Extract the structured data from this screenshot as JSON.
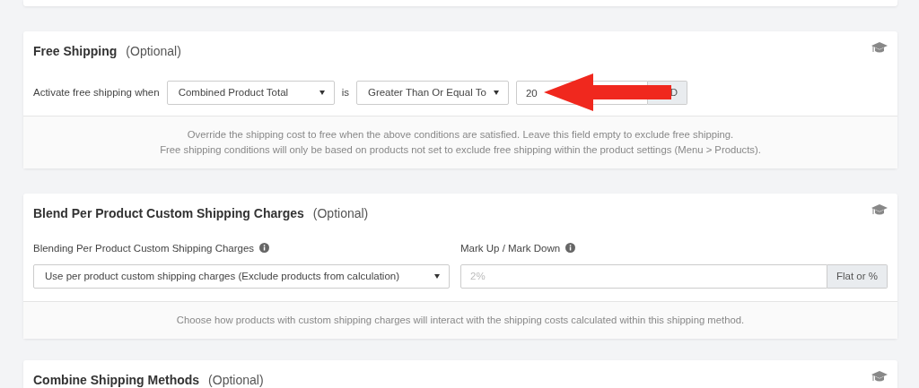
{
  "free_shipping": {
    "title": "Free Shipping",
    "tag": "(Optional)",
    "condition_label": "Activate free shipping when",
    "field_select": "Combined Product Total",
    "connector": "is",
    "operator_select": "Greater Than Or Equal To",
    "amount_value": "20",
    "amount_addon": "D",
    "notes": [
      "Override the shipping cost to free when the above conditions are satisfied. Leave this field empty to exclude free shipping.",
      "Free shipping conditions will only be based on products not set to exclude free shipping within the product settings (Menu > Products)."
    ]
  },
  "blend": {
    "title": "Blend Per Product Custom Shipping Charges",
    "tag": "(Optional)",
    "blend_label": "Blending Per Product Custom Shipping Charges",
    "blend_select": "Use per product custom shipping charges (Exclude products from calculation)",
    "markup_label": "Mark Up / Mark Down",
    "markup_placeholder": "2%",
    "markup_addon": "Flat or %",
    "note": "Choose how products with custom shipping charges will interact with the shipping costs calculated within this shipping method."
  },
  "combine": {
    "title": "Combine Shipping Methods",
    "tag": "(Optional)"
  }
}
